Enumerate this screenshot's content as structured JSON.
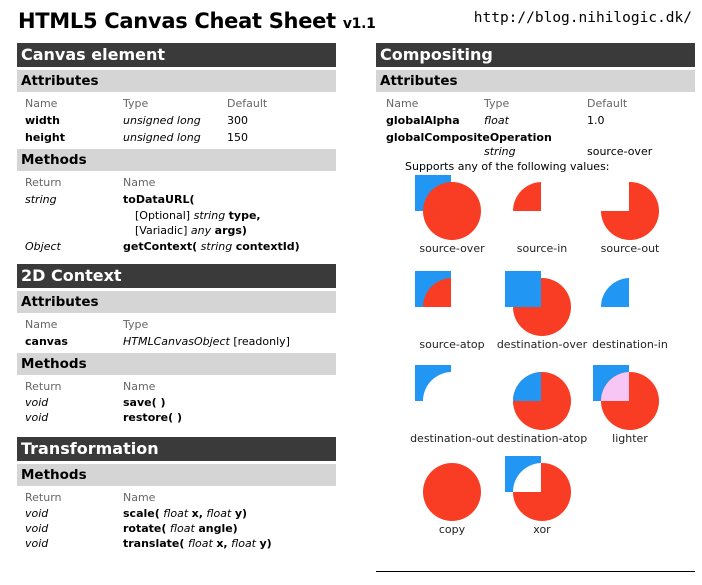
{
  "header": {
    "title": "HTML5 Canvas Cheat Sheet",
    "version": "v1.1",
    "url": "http://blog.nihilogic.dk/"
  },
  "canvas_element": {
    "section": "Canvas element",
    "attributes_title": "Attributes",
    "attr_headers": [
      "Name",
      "Type",
      "Default"
    ],
    "attributes": [
      {
        "name": "width",
        "type": "unsigned long",
        "default": "300"
      },
      {
        "name": "height",
        "type": "unsigned long",
        "default": "150"
      }
    ],
    "methods_title": "Methods",
    "method_headers": [
      "Return",
      "Name"
    ],
    "todataurl": {
      "return": "string",
      "name": "toDataURL(",
      "opt_prefix": "[Optional]",
      "opt_type": "string",
      "opt_name": "type,",
      "var_prefix": "[Variadic]",
      "var_type": "any",
      "var_name": "args)"
    },
    "getcontext": {
      "return": "Object",
      "name": "getContext(",
      "arg_type": "string",
      "arg_name": "contextId)"
    }
  },
  "context2d": {
    "section": "2D Context",
    "attributes_title": "Attributes",
    "attr_headers": [
      "Name",
      "Type"
    ],
    "canvas_name": "canvas",
    "canvas_type": "HTMLCanvasObject",
    "canvas_note": "[readonly]",
    "methods_title": "Methods",
    "method_headers": [
      "Return",
      "Name"
    ],
    "methods": [
      {
        "return": "void",
        "name": "save( )"
      },
      {
        "return": "void",
        "name": "restore( )"
      }
    ]
  },
  "transformation": {
    "section": "Transformation",
    "methods_title": "Methods",
    "method_headers": [
      "Return",
      "Name"
    ],
    "scale": {
      "return": "void",
      "name": "scale(",
      "t1": "float",
      "a1": "x,",
      "t2": "float",
      "a2": "y)"
    },
    "rotate": {
      "return": "void",
      "name": "rotate(",
      "t1": "float",
      "a1": "angle)"
    },
    "translate": {
      "return": "void",
      "name": "translate(",
      "t1": "float",
      "a1": "x,",
      "t2": "float",
      "a2": "y)"
    }
  },
  "compositing": {
    "section": "Compositing",
    "attributes_title": "Attributes",
    "attr_headers": [
      "Name",
      "Type",
      "Default"
    ],
    "global_alpha": {
      "name": "globalAlpha",
      "type": "float",
      "default": "1.0"
    },
    "global_comp": {
      "name": "globalCompositeOperation",
      "type": "string",
      "default": "source-over"
    },
    "supports_text": "Supports any of the following values:",
    "colors": {
      "blue": "#2196f3",
      "red": "#f93d24",
      "lighter": "#f8c6f4"
    },
    "operations": [
      "source-over",
      "source-in",
      "source-out",
      "source-atop",
      "destination-over",
      "destination-in",
      "destination-out",
      "destination-atop",
      "lighter",
      "copy",
      "xor"
    ]
  }
}
